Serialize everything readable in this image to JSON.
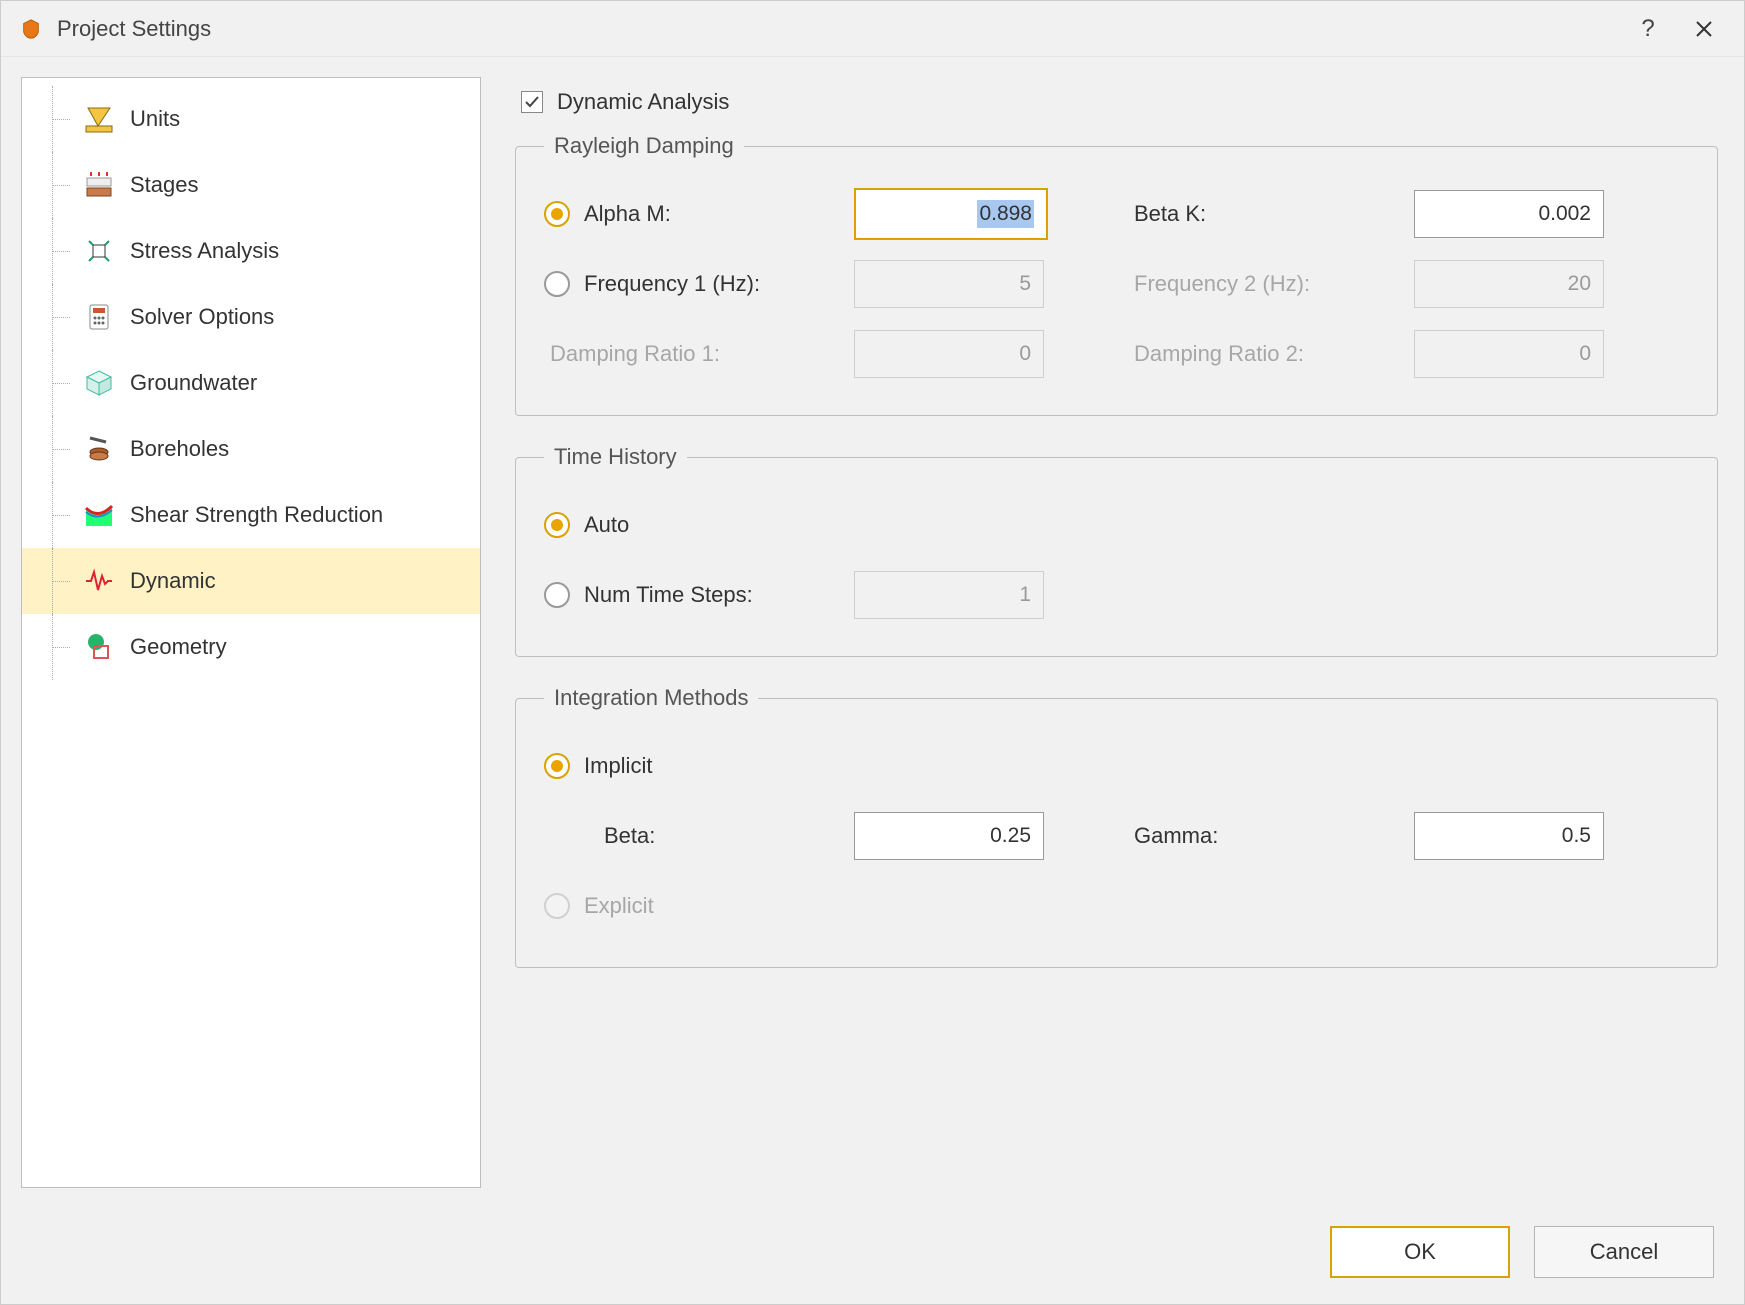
{
  "window": {
    "title": "Project Settings"
  },
  "sidebar": {
    "items": [
      {
        "label": "Units"
      },
      {
        "label": "Stages"
      },
      {
        "label": "Stress Analysis"
      },
      {
        "label": "Solver Options"
      },
      {
        "label": "Groundwater"
      },
      {
        "label": "Boreholes"
      },
      {
        "label": "Shear Strength Reduction"
      },
      {
        "label": "Dynamic",
        "selected": true
      },
      {
        "label": "Geometry"
      }
    ]
  },
  "main": {
    "dynamic_analysis_label": "Dynamic Analysis",
    "dynamic_analysis_checked": true,
    "rayleigh": {
      "legend": "Rayleigh Damping",
      "alpha_m_label": "Alpha M:",
      "alpha_m_value": "0.898",
      "beta_k_label": "Beta K:",
      "beta_k_value": "0.002",
      "freq1_label": "Frequency 1 (Hz):",
      "freq1_value": "5",
      "freq2_label": "Frequency 2 (Hz):",
      "freq2_value": "20",
      "damping1_label": "Damping Ratio 1:",
      "damping1_value": "0",
      "damping2_label": "Damping Ratio 2:",
      "damping2_value": "0"
    },
    "time_history": {
      "legend": "Time History",
      "auto_label": "Auto",
      "num_steps_label": "Num Time Steps:",
      "num_steps_value": "1"
    },
    "integration": {
      "legend": "Integration Methods",
      "implicit_label": "Implicit",
      "beta_label": "Beta:",
      "beta_value": "0.25",
      "gamma_label": "Gamma:",
      "gamma_value": "0.5",
      "explicit_label": "Explicit"
    }
  },
  "footer": {
    "ok_label": "OK",
    "cancel_label": "Cancel"
  }
}
